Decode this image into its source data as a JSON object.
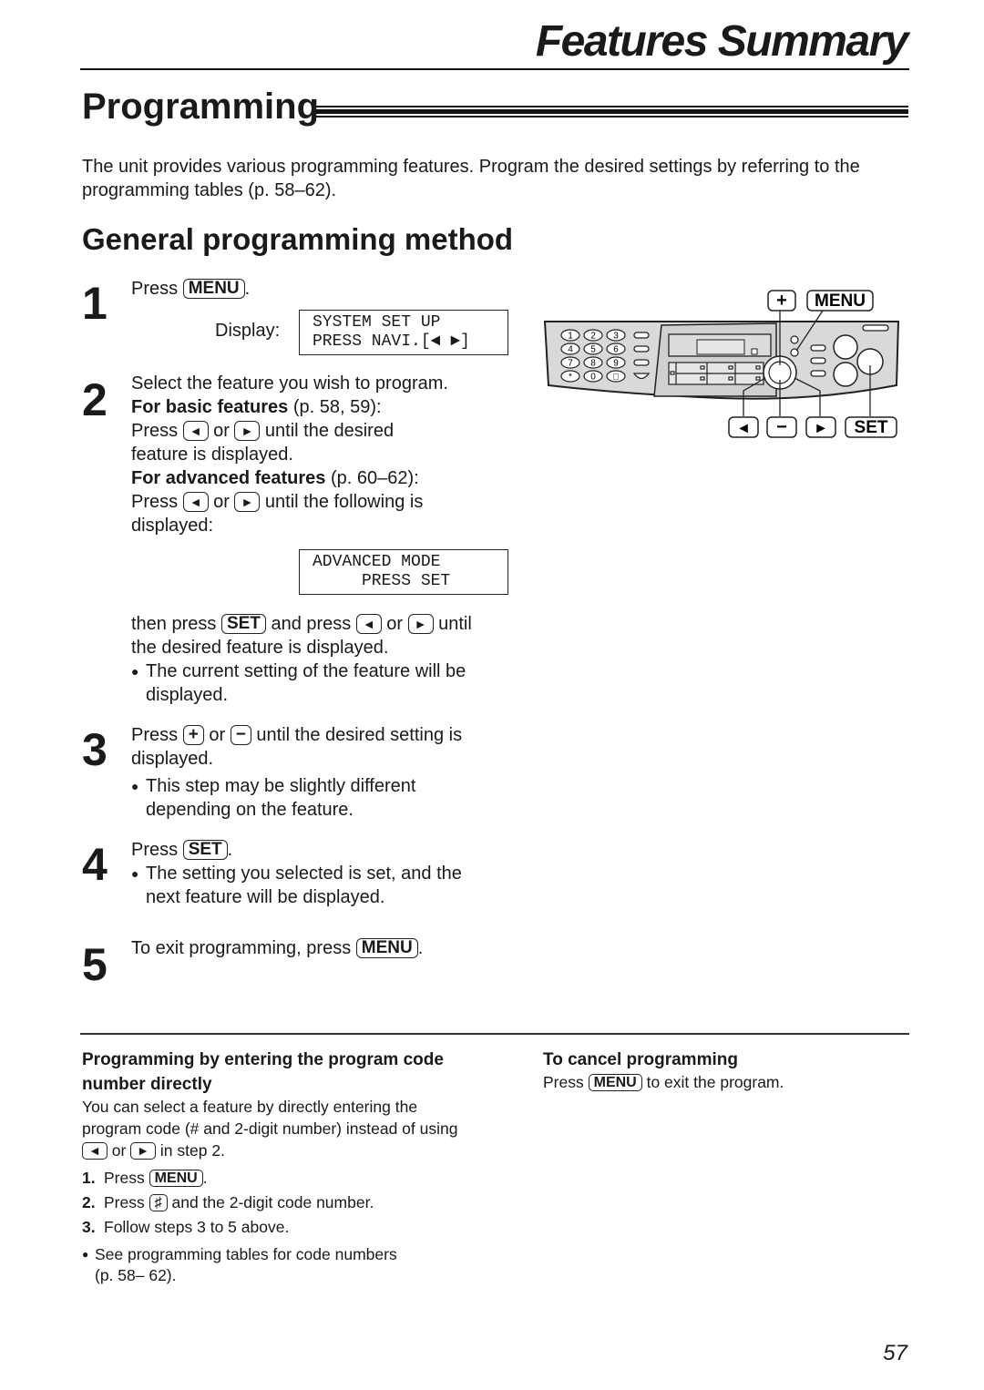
{
  "header": {
    "title": "Features Summary"
  },
  "section": {
    "title": "Programming",
    "intro": "The unit provides various programming features. Program the desired settings by referring to the programming tables (p. 58–62)."
  },
  "method": {
    "title": "General programming method",
    "steps": [
      {
        "number": "1",
        "press": "Press",
        "key": "MENU",
        "end": ".",
        "display_label": "Display:",
        "lcd": [
          "SYSTEM SET UP",
          "PRESS NAVI.[◄ ►]"
        ]
      },
      {
        "number": "2",
        "line1": "Select the feature you wish to program.",
        "basic_label": "For basic features",
        "basic_pages": " (p. 58, 59):",
        "basic_press": "Press",
        "or": "or",
        "basic_until": "until the desired",
        "basic_line2": "feature is displayed.",
        "adv_label": "For advanced features",
        "adv_pages": " (p. 60–62):",
        "adv_press": "Press",
        "adv_until": "until the following is",
        "adv_line2": "displayed:",
        "lcd": [
          "ADVANCED MODE",
          "     PRESS SET"
        ],
        "then_press": "then press",
        "set_key": "SET",
        "and_press": "and press",
        "until": "until",
        "then_line2": "the desired feature is displayed.",
        "bullet": "The current setting of the feature will be\ndisplayed."
      },
      {
        "number": "3",
        "press": "Press",
        "or": "or",
        "until": "until the desired setting is",
        "line2": "displayed.",
        "bullet": "This step may be slightly different\ndepending on the feature."
      },
      {
        "number": "4",
        "press": "Press",
        "key": "SET",
        "end": ".",
        "bullet": "The setting you selected is set, and the\nnext feature will be displayed."
      },
      {
        "number": "5",
        "text": "To exit programming, press",
        "key": "MENU",
        "end": "."
      }
    ]
  },
  "keys": {
    "left_arrow": "◄",
    "right_arrow": "►",
    "plus": "+",
    "minus": "−",
    "hash": "♯"
  },
  "panel_diagram": {
    "labels": {
      "plus": "+",
      "menu": "MENU",
      "left": "◄",
      "minus": "−",
      "right": "►",
      "set": "SET"
    },
    "keypad": [
      "1",
      "2",
      "3",
      "4",
      "5",
      "6",
      "7",
      "8",
      "9",
      "*",
      "0",
      "#"
    ]
  },
  "direct": {
    "title": "Programming by entering the program code number directly",
    "title_line1": "Programming by entering the program code",
    "title_line2": "number directly",
    "body_line1": "You can select a feature by directly entering the",
    "body_line2": "program code (# and 2-digit number) instead of using",
    "or": "or",
    "body_line3_end": "in step 2.",
    "list": [
      {
        "num": "1.",
        "pre": "Press",
        "key": "MENU",
        "post": "."
      },
      {
        "num": "2.",
        "pre": "Press",
        "key": "♯",
        "post": "and the 2-digit code number."
      },
      {
        "num": "3.",
        "pre": "Follow steps 3 to 5 above.",
        "key": "",
        "post": ""
      }
    ],
    "note": "See programming tables for code numbers\n(p. 58– 62)."
  },
  "cancel": {
    "title": "To cancel programming",
    "pre": "Press",
    "key": "MENU",
    "post": "to exit the program."
  },
  "page_number": "57"
}
